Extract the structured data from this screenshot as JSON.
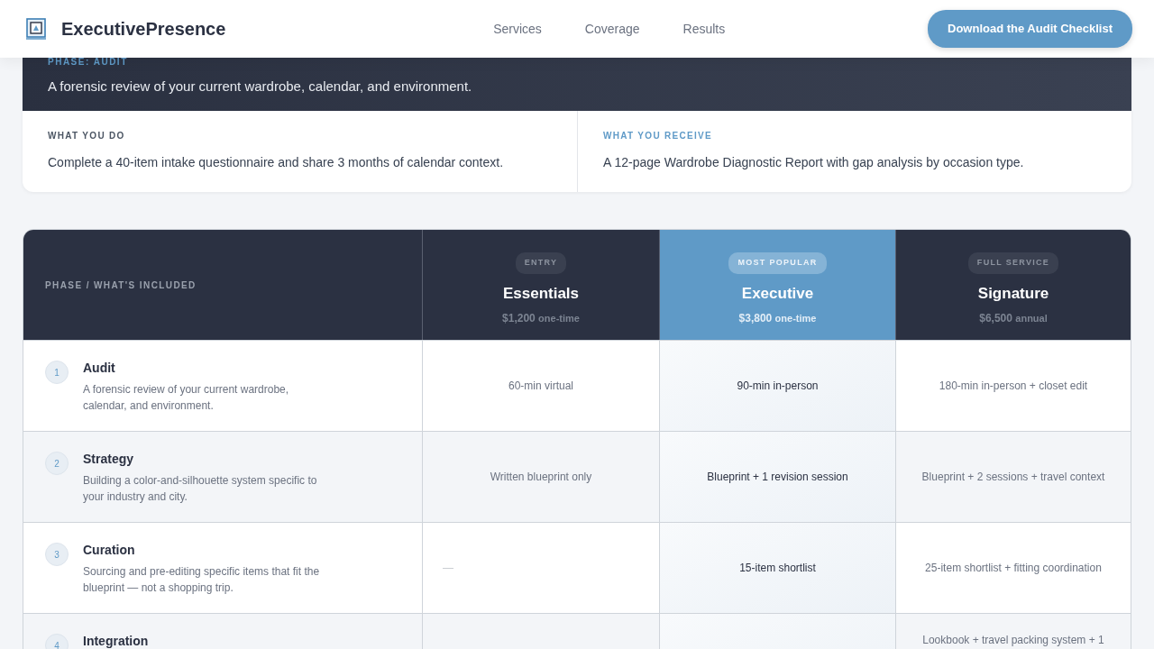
{
  "nav": {
    "brand": "ExecutivePresence",
    "links": [
      "Services",
      "Coverage",
      "Results"
    ],
    "cta": "Download the Audit Checklist"
  },
  "phase_card": {
    "label": "PHASE: AUDIT",
    "description": "A forensic review of your current wardrobe, calendar, and environment.",
    "do_label": "WHAT YOU DO",
    "do_text": "Complete a 40-item intake questionnaire and share 3 months of calendar context.",
    "receive_label": "WHAT YOU RECEIVE",
    "receive_text": "A 12-page Wardrobe Diagnostic Report with gap analysis by occasion type."
  },
  "table": {
    "header_label": "PHASE / WHAT'S INCLUDED",
    "tiers": [
      {
        "badge": "ENTRY",
        "name": "Essentials",
        "price": "$1,200",
        "term": "one-time",
        "featured": false
      },
      {
        "badge": "MOST POPULAR",
        "name": "Executive",
        "price": "$3,800",
        "term": "one-time",
        "featured": true
      },
      {
        "badge": "FULL SERVICE",
        "name": "Signature",
        "price": "$6,500",
        "term": "annual",
        "featured": false
      }
    ],
    "rows": [
      {
        "number": "1",
        "title": "Audit",
        "description": "A forensic review of your current wardrobe, calendar, and environment.",
        "cells": [
          {
            "kind": "text",
            "text": "60-min virtual"
          },
          {
            "kind": "text",
            "text": "90-min in-person"
          },
          {
            "kind": "text",
            "text": "180-min in-person + closet edit"
          }
        ]
      },
      {
        "number": "2",
        "title": "Strategy",
        "description": "Building a color-and-silhouette system specific to your industry and city.",
        "cells": [
          {
            "kind": "text",
            "text": "Written blueprint only"
          },
          {
            "kind": "text",
            "text": "Blueprint + 1 revision session"
          },
          {
            "kind": "text",
            "text": "Blueprint + 2 sessions + travel context"
          }
        ]
      },
      {
        "number": "3",
        "title": "Curation",
        "description": "Sourcing and pre-editing specific items that fit the blueprint — not a shopping trip.",
        "cells": [
          {
            "kind": "dash",
            "text": "—"
          },
          {
            "kind": "text",
            "text": "15-item shortlist"
          },
          {
            "kind": "text",
            "text": "25-item shortlist + fitting coordination"
          }
        ]
      },
      {
        "number": "4",
        "title": "Integration",
        "cells": [
          {
            "kind": "blank"
          },
          {
            "kind": "blank"
          },
          {
            "kind": "text",
            "text": "Lookbook + travel packing system + 1"
          }
        ]
      }
    ]
  }
}
